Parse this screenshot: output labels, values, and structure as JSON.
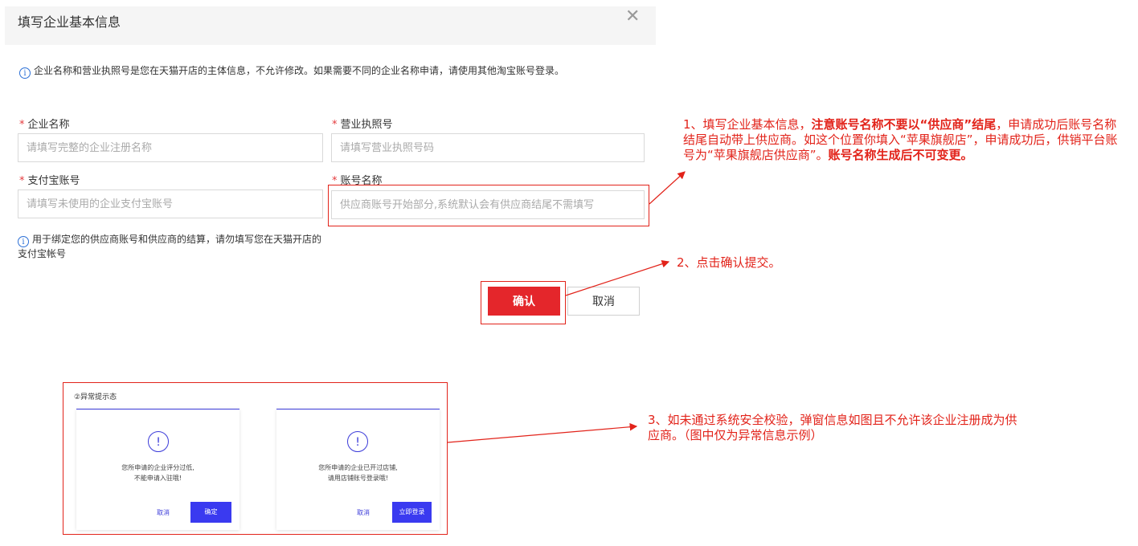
{
  "dialog": {
    "title": "填写企业基本信息",
    "close_glyph": "✕",
    "notice": "企业名称和营业执照号是您在天猫开店的主体信息，不允许修改。如果需要不同的企业名称申请，请使用其他淘宝账号登录。"
  },
  "form": {
    "required_mark": "*",
    "company_name": {
      "label": "企业名称",
      "placeholder": "请填写完整的企业注册名称"
    },
    "license_no": {
      "label": "营业执照号",
      "placeholder": "请填写营业执照号码"
    },
    "alipay": {
      "label": "支付宝账号",
      "placeholder": "请填写未使用的企业支付宝账号"
    },
    "account_name": {
      "label": "账号名称",
      "placeholder": "供应商账号开始部分,系统默认会有供应商结尾不需填写"
    },
    "hint": "用于绑定您的供应商账号和供应商的结算，请勿填写您在天猫开店的支付宝帐号"
  },
  "buttons": {
    "confirm": "确认",
    "cancel": "取消"
  },
  "annotations": {
    "a1_part1": "1、填写企业基本信息，",
    "a1_bold1": "注意账号名称不要以“供应商”结尾",
    "a1_part2": "，申请成功后账号名称结尾自动带上供应商。如这个位置你填入“苹果旗舰店”，申请成功后，供销平台账号为“苹果旗舰店供应商”。",
    "a1_bold2": "账号名称生成后不可变更。",
    "a2": "2、点击确认提交。",
    "a3": "3、如未通过系统安全校验，弹窗信息如图且不允许该企业注册成为供应商。（图中仅为异常信息示例）"
  },
  "example": {
    "title": "②异常提示态",
    "icon_glyph": "!",
    "card1": {
      "msg_line1": "您所申请的企业评分过低,",
      "msg_line2": "不能申请入驻哦!",
      "cancel": "取消",
      "ok": "确定"
    },
    "card2": {
      "msg_line1": "您所申请的企业已开过店铺,",
      "msg_line2": "请用店铺账号登录哦!",
      "cancel": "取消",
      "ok": "立即登录"
    }
  },
  "colors": {
    "accent_red": "#e4262b",
    "annotation_red": "#e2231a",
    "info_blue": "#2b6fd6",
    "mini_blue": "#3a3af0"
  }
}
